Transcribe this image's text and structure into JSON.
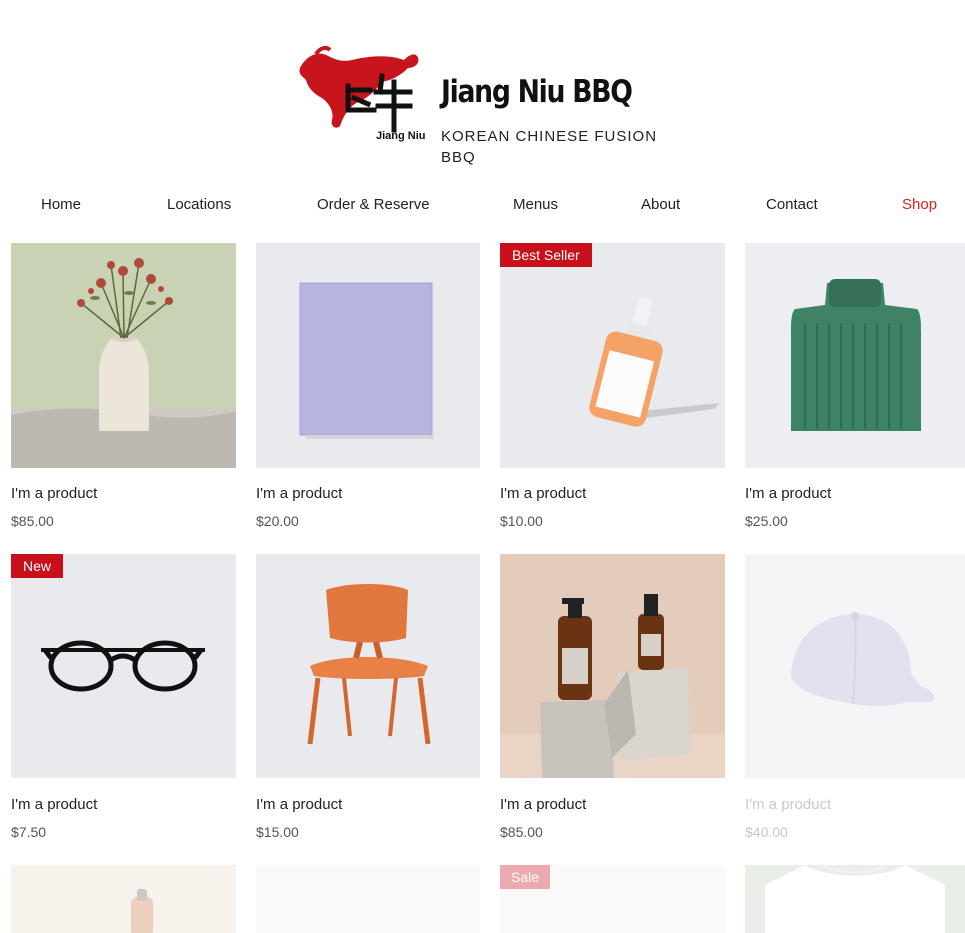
{
  "brand": {
    "title": "Jiang Niu BBQ",
    "subtitle": "KOREAN CHINESE FUSION BBQ",
    "logo_text": "Jiang Niu"
  },
  "nav": {
    "items": [
      {
        "label": "Home"
      },
      {
        "label": "Locations"
      },
      {
        "label": "Order & Reserve"
      },
      {
        "label": "Menus"
      },
      {
        "label": "About"
      },
      {
        "label": "Contact"
      },
      {
        "label": "Shop",
        "active": true
      }
    ]
  },
  "colors": {
    "accent": "#d6251e",
    "ribbon": "#c9101a"
  },
  "products": [
    {
      "name": "I'm a product",
      "price": "$85.00",
      "image": "vase-with-flowers"
    },
    {
      "name": "I'm a product",
      "price": "$20.00",
      "image": "tote-bag"
    },
    {
      "name": "I'm a product",
      "price": "$10.00",
      "image": "serum-bottle",
      "ribbon": "Best Seller"
    },
    {
      "name": "I'm a product",
      "price": "$25.00",
      "image": "green-sweater"
    },
    {
      "name": "I'm a product",
      "price": "$7.50",
      "image": "eyeglasses",
      "ribbon": "New"
    },
    {
      "name": "I'm a product",
      "price": "$15.00",
      "image": "wooden-chair"
    },
    {
      "name": "I'm a product",
      "price": "$85.00",
      "image": "amber-bottles"
    },
    {
      "name": "I'm a product",
      "price": "$40.00",
      "image": "baseball-cap"
    },
    {
      "image": "water-bottle"
    },
    {
      "image": "blank-product"
    },
    {
      "image": "sale-product",
      "ribbon": "Sale"
    },
    {
      "image": "white-tshirt"
    }
  ]
}
